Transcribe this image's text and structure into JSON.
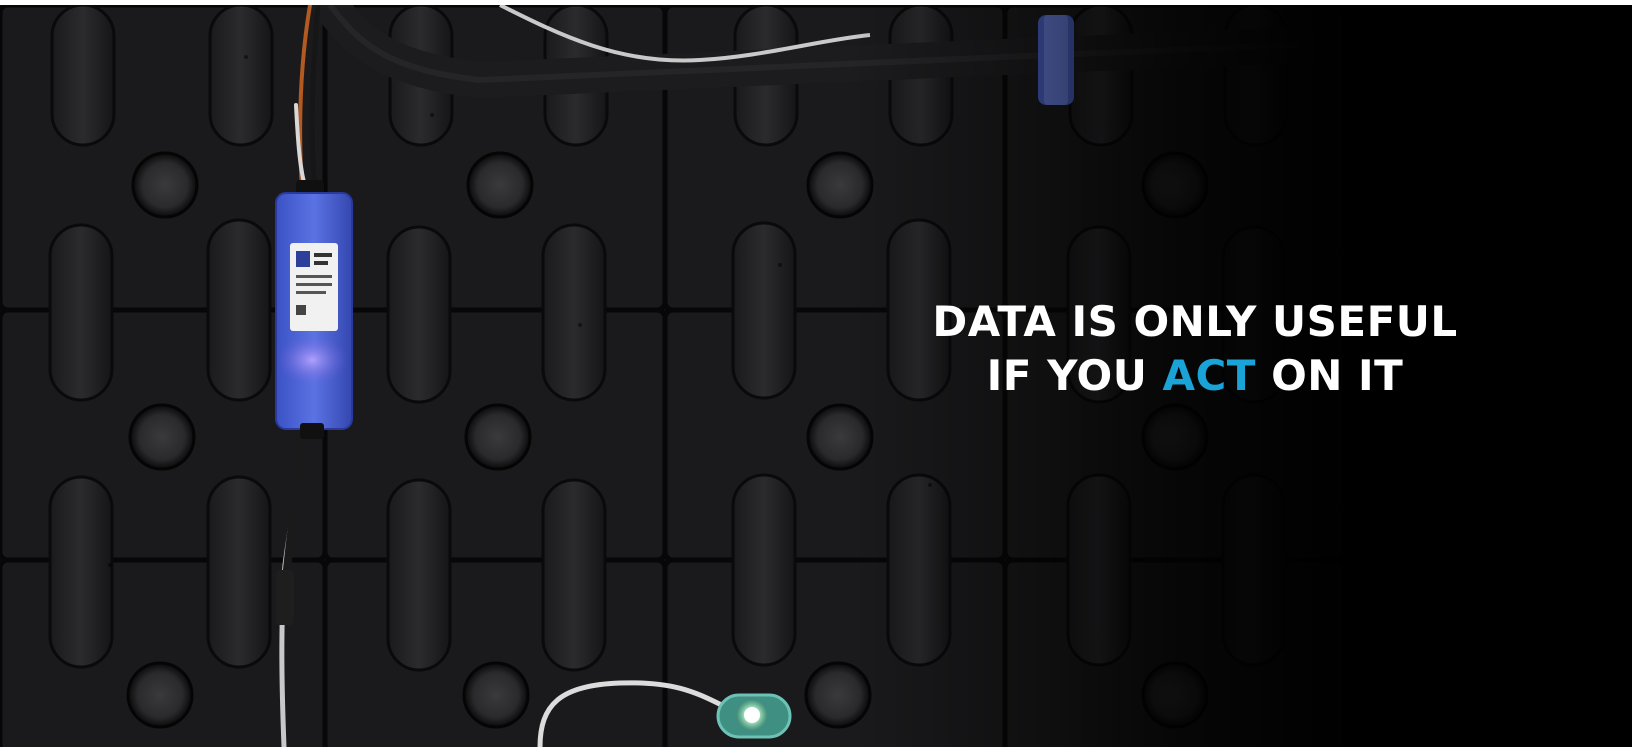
{
  "hero": {
    "headline_line1": "DATA IS ONLY USEFUL",
    "headline_line2_pre": "IF YOU ",
    "headline_line2_accent": "ACT",
    "headline_line2_post": " ON IT",
    "accent_color": "#1aa3d6",
    "text_color": "#ffffff",
    "photo_subject": "battery-cell-tops-with-blue-monitoring-sensor",
    "monitor_device_color": "#4a63d6",
    "indicator_led_color": "#9dffb8"
  }
}
